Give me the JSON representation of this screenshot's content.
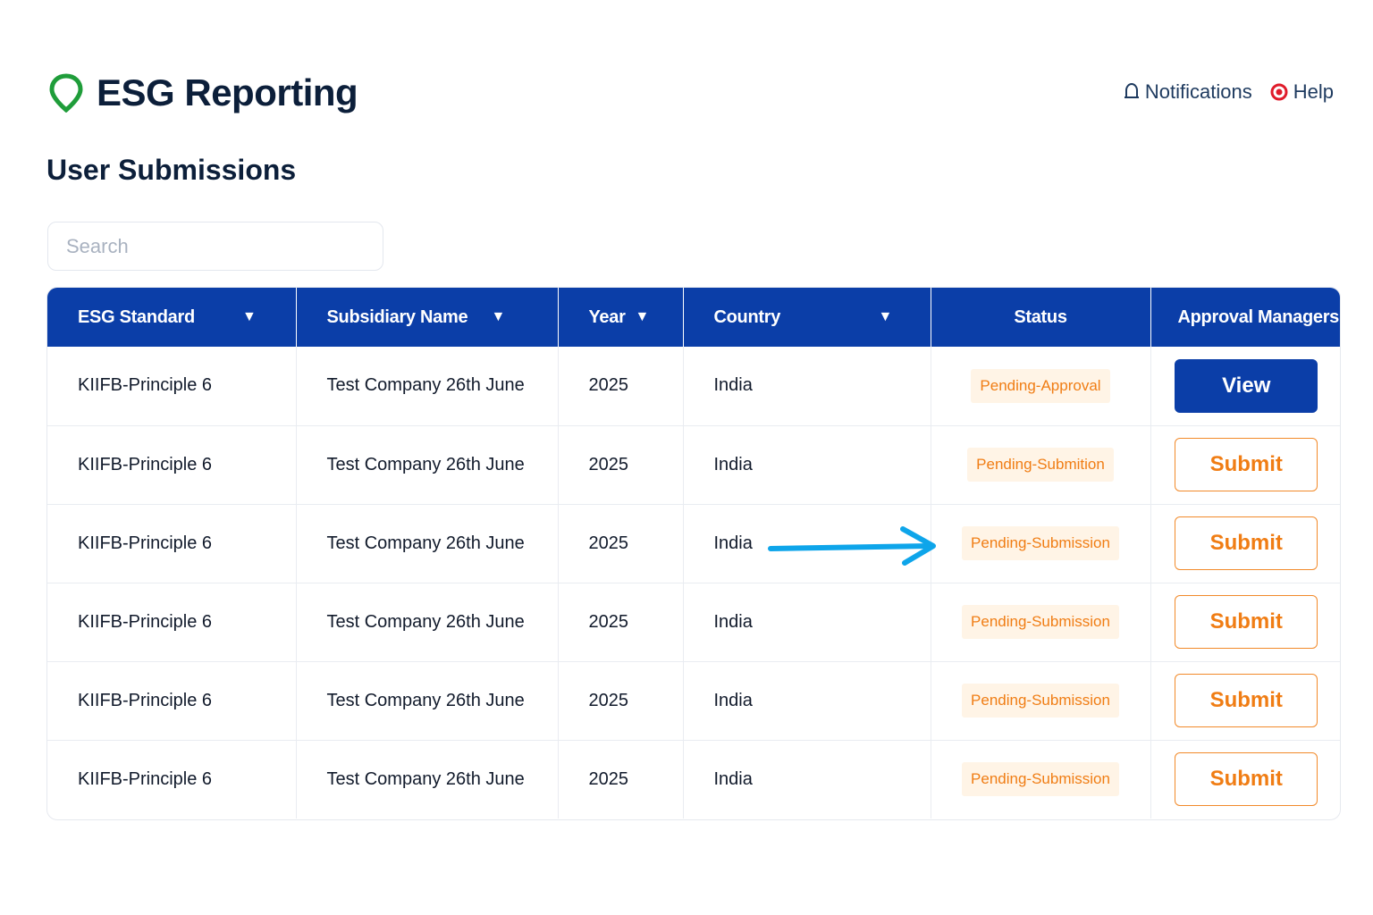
{
  "app": {
    "title": "ESG Reporting",
    "notifications_label": "Notifications",
    "help_label": "Help",
    "brand_color": "#1f9d3a",
    "accent_color": "#0b3ea8",
    "icons": [
      "location-pin-icon",
      "bell-icon",
      "help-icon"
    ]
  },
  "page": {
    "title": "User Submissions"
  },
  "search": {
    "placeholder": "Search",
    "value": ""
  },
  "table": {
    "columns": [
      {
        "label": "ESG Standard",
        "sortable": true
      },
      {
        "label": "Subsidiary Name",
        "sortable": true
      },
      {
        "label": "Year",
        "sortable": true
      },
      {
        "label": "Country",
        "sortable": true
      },
      {
        "label": "Status",
        "sortable": false
      },
      {
        "label": "Approval Managers",
        "sortable": false
      }
    ],
    "caret": "▼",
    "rows": [
      {
        "standard": "KIIFB-Principle 6",
        "subsidiary": "Test Company 26th June",
        "year": "2025",
        "country": "India",
        "status": "Pending-Approval",
        "action": "View"
      },
      {
        "standard": "KIIFB-Principle 6",
        "subsidiary": "Test Company 26th June",
        "year": "2025",
        "country": "India",
        "status": "Pending-Submition",
        "action": "Submit"
      },
      {
        "standard": "KIIFB-Principle 6",
        "subsidiary": "Test Company 26th June",
        "year": "2025",
        "country": "India",
        "status": "Pending-Submission",
        "action": "Submit"
      },
      {
        "standard": "KIIFB-Principle 6",
        "subsidiary": "Test Company 26th June",
        "year": "2025",
        "country": "India",
        "status": "Pending-Submission",
        "action": "Submit"
      },
      {
        "standard": "KIIFB-Principle 6",
        "subsidiary": "Test Company 26th June",
        "year": "2025",
        "country": "India",
        "status": "Pending-Submission",
        "action": "Submit"
      },
      {
        "standard": "KIIFB-Principle 6",
        "subsidiary": "Test Company 26th June",
        "year": "2025",
        "country": "India",
        "status": "Pending-Submission",
        "action": "Submit"
      }
    ],
    "status_color": "#f07d14",
    "status_bg": "#fff4e6"
  },
  "annotation": {
    "arrow_color": "#0ea5ea",
    "points_to_row": 3
  }
}
